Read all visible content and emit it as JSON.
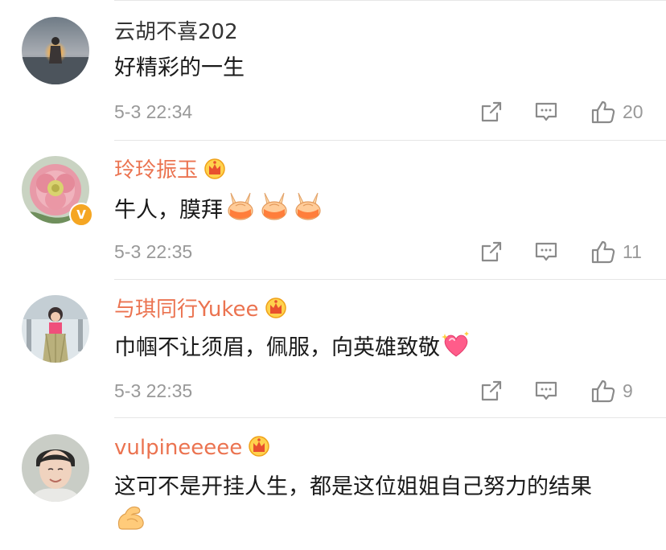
{
  "comments": [
    {
      "username": "云胡不喜202",
      "is_vip": false,
      "verified": false,
      "text": "好精彩的一生",
      "emojis": [],
      "time": "5-3 22:34",
      "likes": "20"
    },
    {
      "username": "玲玲振玉",
      "is_vip": true,
      "verified": true,
      "text": "牛人，膜拜",
      "emojis": [
        "pray-hands-emoji",
        "pray-hands-emoji",
        "pray-hands-emoji"
      ],
      "time": "5-3 22:35",
      "likes": "11"
    },
    {
      "username": "与琪同行Yukee",
      "is_vip": true,
      "verified": false,
      "text": "巾帼不让须眉，佩服，向英雄致敬",
      "emojis": [
        "sparkling-heart-emoji"
      ],
      "time": "5-3 22:35",
      "likes": "9"
    },
    {
      "username": "vulpineeeee",
      "is_vip": true,
      "verified": false,
      "text": "这可不是开挂人生，都是这位姐姐自己努力的结果",
      "emojis": [
        "flexed-biceps-emoji"
      ],
      "time": "",
      "likes": ""
    }
  ],
  "colors": {
    "vip_name": "#eb7350",
    "normal_name": "#333333",
    "meta": "#999999",
    "badge": "#f5a623"
  },
  "icons": [
    "share-icon",
    "comment-icon",
    "like-icon",
    "crown-icon"
  ]
}
